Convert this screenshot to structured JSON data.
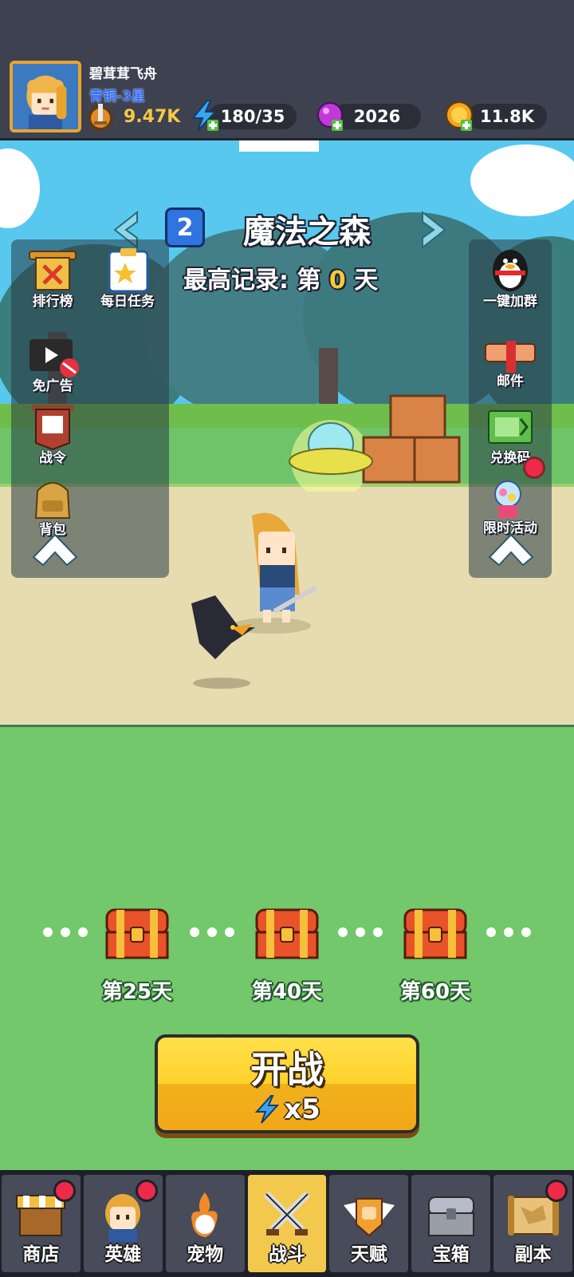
{
  "player": {
    "name": "碧茸茸飞舟",
    "rank": "青铜-3星",
    "power": "9.47K"
  },
  "resources": {
    "energy": "180/35",
    "gems": "2026",
    "coins": "11.8K"
  },
  "level": {
    "number": "2",
    "name": "魔法之森",
    "record_prefix": "最高记录: 第",
    "record_day": "0",
    "record_suffix": "天"
  },
  "left_menu": {
    "ranking": "排行榜",
    "daily_tasks": "每日任务",
    "no_ads": "免广告",
    "battle_pass": "战令",
    "backpack": "背包"
  },
  "right_menu": {
    "join_group": "一键加群",
    "mail": "邮件",
    "redeem_code": "兑换码",
    "limited_event": "限时活动"
  },
  "rewards": [
    {
      "label": "第25天"
    },
    {
      "label": "第40天"
    },
    {
      "label": "第60天"
    }
  ],
  "battle_button": {
    "label": "开战",
    "cost": "x5"
  },
  "nav": [
    {
      "label": "商店",
      "badge": true
    },
    {
      "label": "英雄",
      "badge": true
    },
    {
      "label": "宠物",
      "badge": false
    },
    {
      "label": "战斗",
      "badge": false,
      "active": true
    },
    {
      "label": "天赋",
      "badge": false
    },
    {
      "label": "宝箱",
      "badge": false
    },
    {
      "label": "副本",
      "badge": true
    }
  ],
  "colors": {
    "sky": "#58c8ef",
    "field": "#72c86a",
    "accent_yellow": "#ffd12c",
    "badge_red": "#ee2a48",
    "rank_blue": "#2f6cff"
  }
}
